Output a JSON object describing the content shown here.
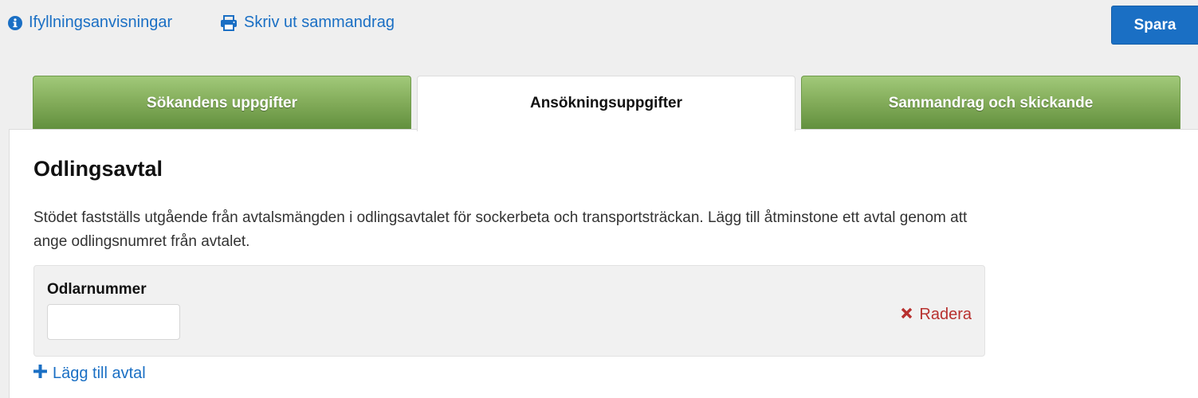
{
  "toolbar": {
    "help_label": "Ifyllningsanvisningar",
    "print_label": "Skriv ut sammandrag",
    "save_label": "Spara"
  },
  "tabs": [
    {
      "label": "Sökandens uppgifter",
      "state": "completed"
    },
    {
      "label": "Ansökningsuppgifter",
      "state": "active"
    },
    {
      "label": "Sammandrag och skickande",
      "state": "completed"
    }
  ],
  "section": {
    "title": "Odlingsavtal",
    "description": "Stödet fastställs utgående från avtalsmängden i odlingsavtalet för sockerbeta och transportsträckan. Lägg till åtminstone ett avtal genom att ange odlingsnumret från avtalet."
  },
  "agreement": {
    "field_label": "Odlarnummer",
    "field_value": "",
    "delete_label": "Radera"
  },
  "add_agreement_label": "Lägg till avtal",
  "colors": {
    "link_blue": "#1a6fc4",
    "tab_green": "#85ae5c",
    "delete_red": "#b8312f",
    "page_bg": "#efefef"
  },
  "icons": {
    "help": "info-circle-icon",
    "print": "printer-icon",
    "delete": "close-icon",
    "add": "plus-icon"
  }
}
